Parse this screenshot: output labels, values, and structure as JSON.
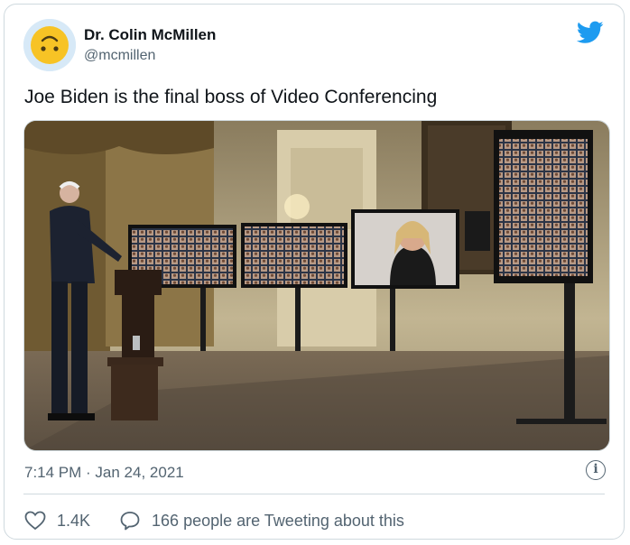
{
  "tweet": {
    "author_name": "Dr. Colin McMillen",
    "author_handle": "@mcmillen",
    "text": "Joe Biden is the final boss of Video Conferencing",
    "timestamp": "7:14 PM · Jan 24, 2021",
    "likes": "1.4K",
    "conversation_label": "166 people are Tweeting about this",
    "brand_color": "#1d9bf0",
    "icons": [
      "upside-down-face-avatar-icon",
      "twitter-bird-icon",
      "info-icon",
      "heart-icon",
      "speech-bubble-icon"
    ]
  }
}
